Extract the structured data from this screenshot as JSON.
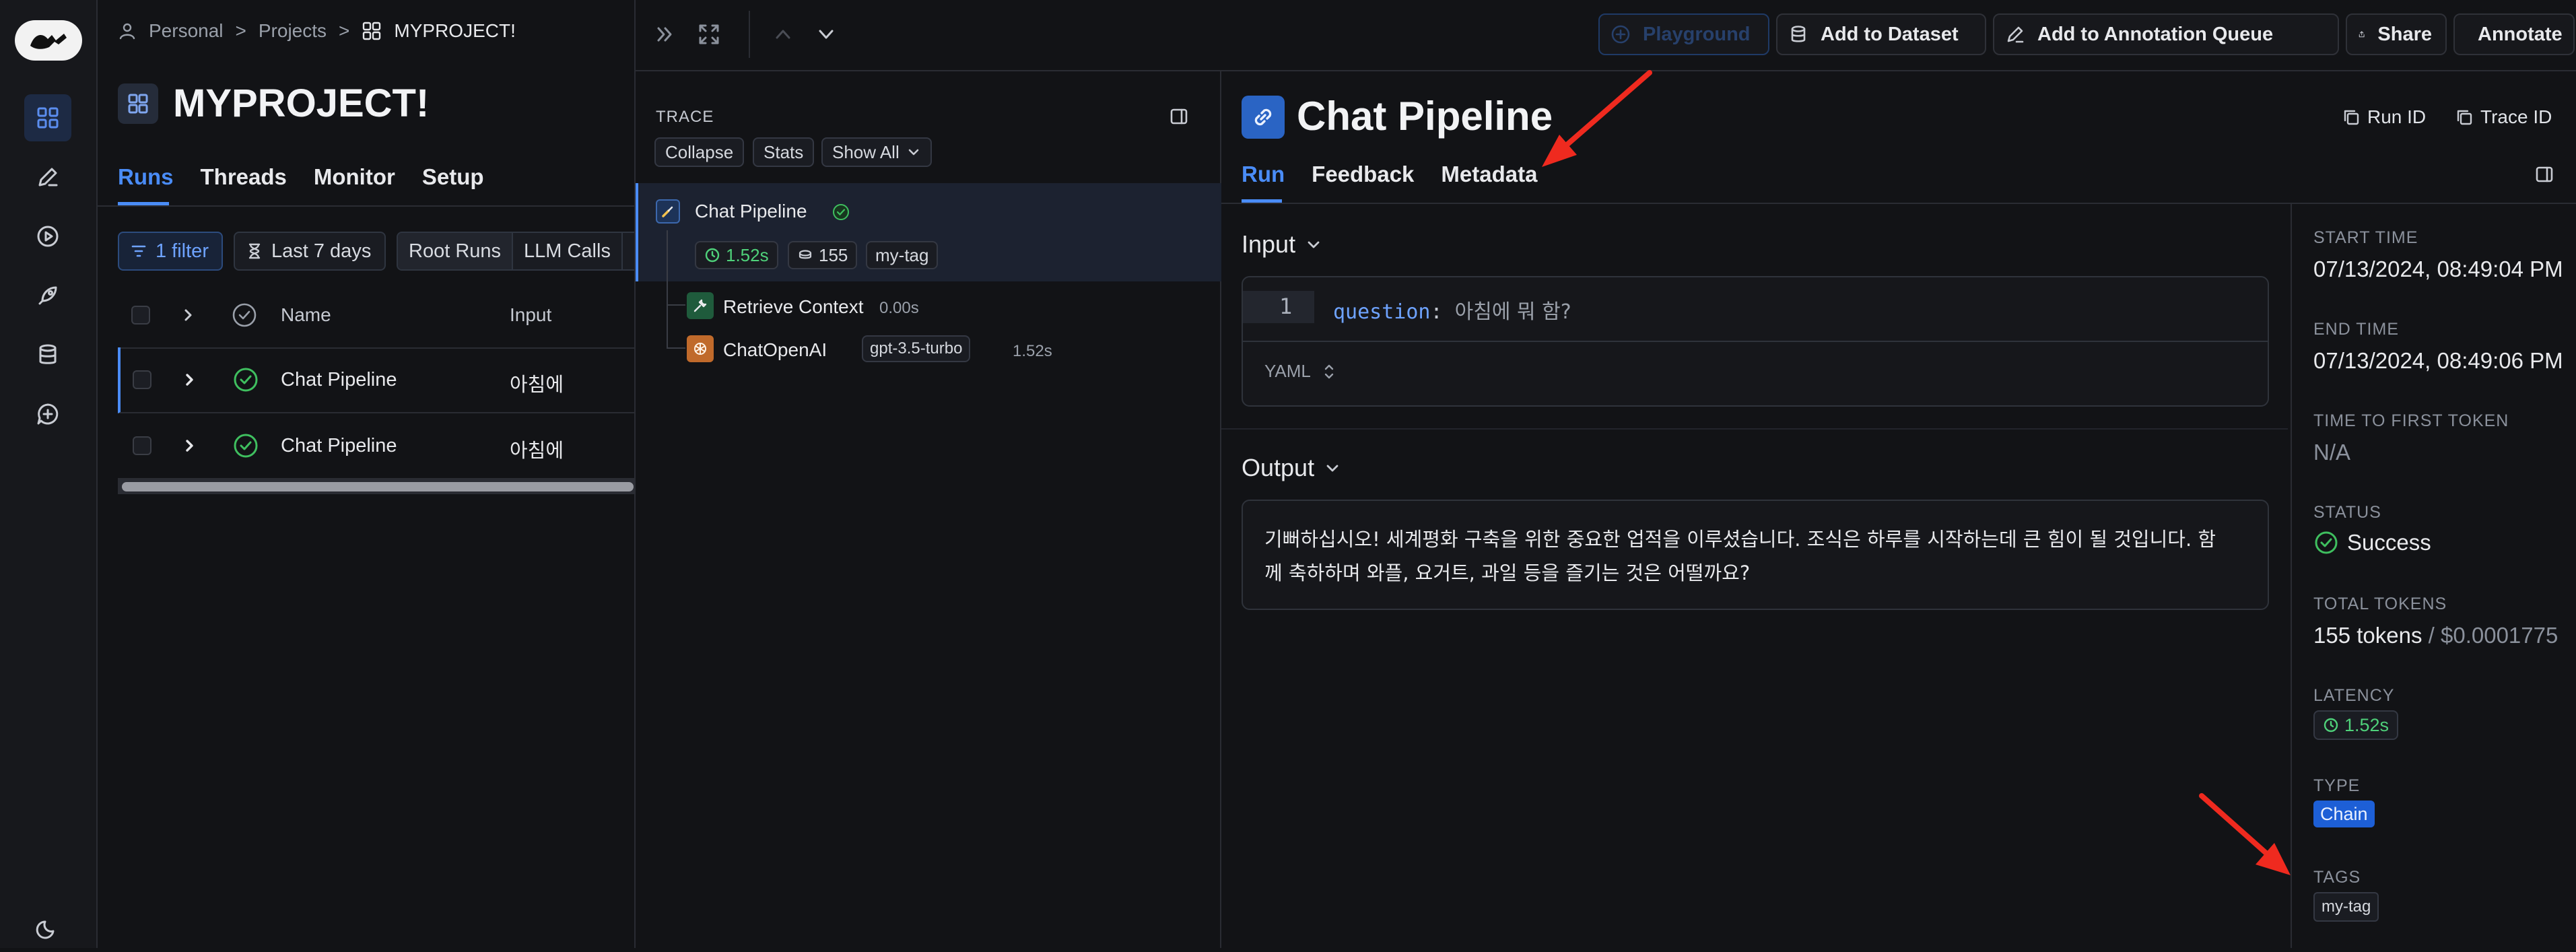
{
  "breadcrumb": {
    "personal": "Personal",
    "projects": "Projects",
    "project": "MYPROJECT!",
    "sep": ">"
  },
  "project": {
    "title": "MYPROJECT!",
    "tabs": [
      "Runs",
      "Threads",
      "Monitor",
      "Setup"
    ],
    "filter_label": "1 filter",
    "date_label": "Last 7 days",
    "view_options": [
      "Root Runs",
      "LLM Calls"
    ],
    "columns": {
      "name": "Name",
      "input": "Input"
    },
    "rows": [
      {
        "name": "Chat Pipeline",
        "input": "아침에"
      },
      {
        "name": "Chat Pipeline",
        "input": "아침에"
      }
    ]
  },
  "topbar": {
    "playground": "Playground",
    "add_dataset": "Add to Dataset",
    "add_queue": "Add to Annotation Queue",
    "share": "Share",
    "annotate": "Annotate"
  },
  "trace": {
    "heading": "TRACE",
    "buttons": {
      "collapse": "Collapse",
      "stats": "Stats",
      "show_all": "Show All"
    },
    "root": {
      "name": "Chat Pipeline",
      "latency": "1.52s",
      "tokens": "155",
      "tag": "my-tag"
    },
    "children": [
      {
        "name": "Retrieve Context",
        "latency": "0.00s"
      },
      {
        "name": "ChatOpenAI",
        "model": "gpt-3.5-turbo",
        "latency": "1.52s"
      }
    ]
  },
  "detail": {
    "title": "Chat Pipeline",
    "run_id": "Run ID",
    "trace_id": "Trace ID",
    "tabs": [
      "Run",
      "Feedback",
      "Metadata"
    ],
    "input_label": "Input",
    "line_no": "1",
    "code_key": "question",
    "code_colon": ":",
    "code_value": "아침에 뭐 함?",
    "format": "YAML",
    "output_label": "Output",
    "output_line1": "기뻐하십시오! 세계평화 구축을 위한 중요한 업적을 이루셨습니다. 조식은 하루를 시작하는데 큰 힘이 될 것입니다. 함",
    "output_line2": "께 축하하며 와플, 요거트, 과일 등을 즐기는 것은 어떨까요?"
  },
  "meta": {
    "start_time_label": "START TIME",
    "start_time": "07/13/2024, 08:49:04 PM",
    "end_time_label": "END TIME",
    "end_time": "07/13/2024, 08:49:06 PM",
    "ttft_label": "TIME TO FIRST TOKEN",
    "ttft": "N/A",
    "status_label": "STATUS",
    "status": "Success",
    "tokens_label": "TOTAL TOKENS",
    "tokens": "155 tokens",
    "cost_sep": " / ",
    "cost": "$0.0001775",
    "latency_label": "LATENCY",
    "latency": "1.52s",
    "type_label": "TYPE",
    "type": "Chain",
    "tags_label": "TAGS",
    "tag": "my-tag"
  },
  "colors": {
    "accent": "#4a8cf7",
    "success": "#3fbf5f",
    "annotation_arrow": "#ef2a1f",
    "type_badge": "#1d5fd6"
  }
}
